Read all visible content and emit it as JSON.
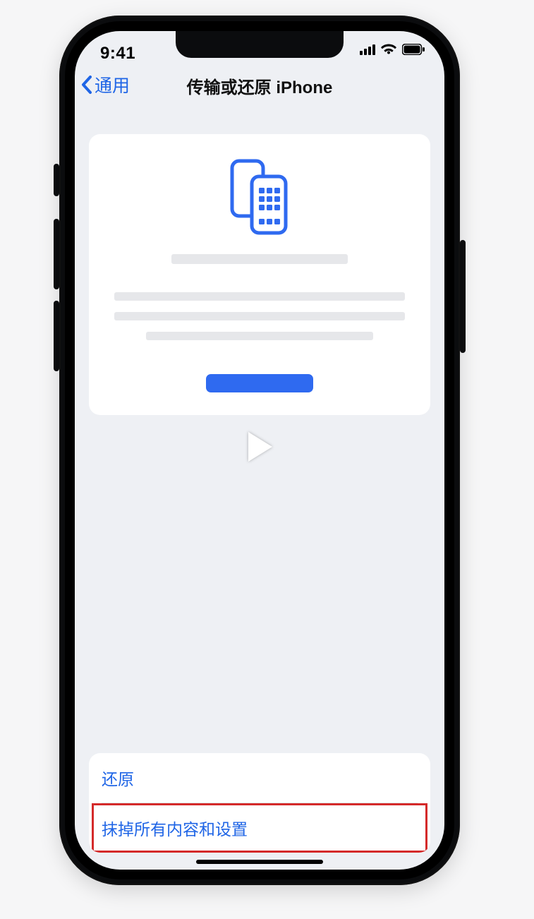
{
  "status": {
    "time": "9:41"
  },
  "nav": {
    "back_label": "通用",
    "title": "传输或还原 iPhone"
  },
  "list": {
    "reset_label": "还原",
    "erase_label": "抹掉所有内容和设置"
  },
  "colors": {
    "link": "#1f65e6",
    "accent": "#2f6af0",
    "highlight": "#d42a2a"
  }
}
